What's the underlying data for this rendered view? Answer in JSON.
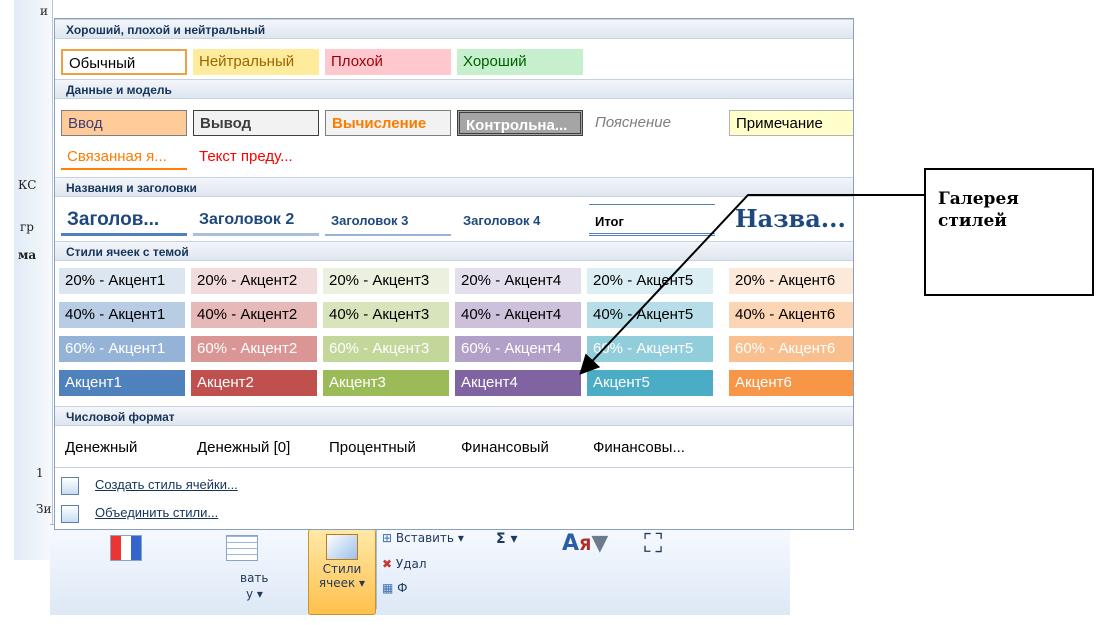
{
  "gallery": {
    "sections": {
      "good_bad": "Хороший, плохой и нейтральный",
      "data_model": "Данные и модель",
      "titles": "Названия и заголовки",
      "themed": "Стили ячеек с темой",
      "number": "Числовой формат"
    },
    "good_bad_styles": [
      "Обычный",
      "Нейтральный",
      "Плохой",
      "Хороший"
    ],
    "data_model_row1": [
      "Ввод",
      "Вывод",
      "Вычисление",
      "Контрольна...",
      "Пояснение",
      "Примечание"
    ],
    "data_model_row2": [
      "Связанная я...",
      "Текст преду..."
    ],
    "titles_styles": [
      "Заголов...",
      "Заголовок 2",
      "Заголовок 3",
      "Заголовок 4",
      "Итог",
      "Назва..."
    ],
    "themed_20": [
      "20% - Акцент1",
      "20% - Акцент2",
      "20% - Акцент3",
      "20% - Акцент4",
      "20% - Акцент5",
      "20% - Акцент6"
    ],
    "themed_40": [
      "40% - Акцент1",
      "40% - Акцент2",
      "40% - Акцент3",
      "40% - Акцент4",
      "40% - Акцент5",
      "40% - Акцент6"
    ],
    "themed_60": [
      "60% - Акцент1",
      "60% - Акцент2",
      "60% - Акцент3",
      "60% - Акцент4",
      "60% - Акцент5",
      "60% - Акцент6"
    ],
    "themed_accent": [
      "Акцент1",
      "Акцент2",
      "Акцент3",
      "Акцент4",
      "Акцент5",
      "Акцент6"
    ],
    "number_styles": [
      "Денежный",
      "Денежный [0]",
      "Процентный",
      "Финансовый",
      "Финансовы..."
    ],
    "new_style_link": "Создать стиль ячейки...",
    "merge_styles_link": "Объединить стили..."
  },
  "ribbon": {
    "styles_button": "Стили\nячеек ▾",
    "format_label_partial": "вать",
    "format_label_partial2": "у ▾",
    "insert": "Вставить ▾",
    "delete": "Удал",
    "format": "Ф",
    "sum": "Σ ▾"
  },
  "background_fragments": [
    "и",
    "КС",
    "гр",
    "ма",
    "1",
    "Зи"
  ],
  "callout": {
    "text": "Галерея\nстилей"
  },
  "colors": {
    "accent1": "#4f81bd",
    "accent2": "#c0504d",
    "accent3": "#9bbb59",
    "accent4": "#8064a2",
    "accent5": "#4bacc6",
    "accent6": "#f79646"
  }
}
